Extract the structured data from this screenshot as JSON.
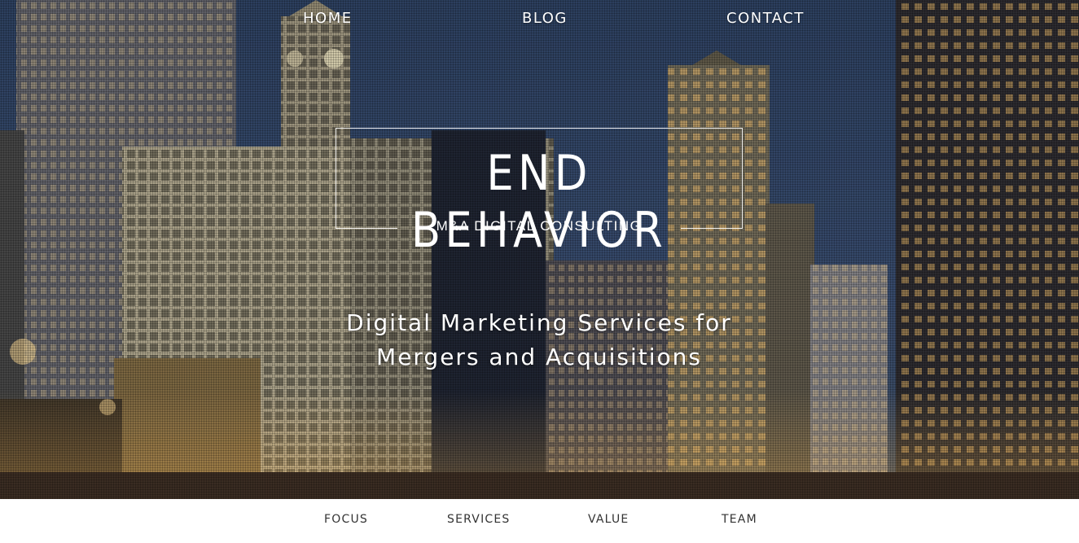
{
  "top_nav": {
    "home": "HOME",
    "blog": "BLOG",
    "contact": "CONTACT"
  },
  "hero": {
    "title": "END BEHAVIOR",
    "subtitle": "M&A DIGITAL CONSULTING",
    "tagline_line1": "Digital Marketing Services for",
    "tagline_line2": "Mergers and Acquisitions",
    "background_image": "city-skyline-photo"
  },
  "sub_nav": {
    "focus": "FOCUS",
    "services": "SERVICES",
    "value": "VALUE",
    "team": "TEAM"
  },
  "colors": {
    "nav_text": "#ffffff",
    "subnav_text": "#333333",
    "sky": "#2c3f5e"
  }
}
